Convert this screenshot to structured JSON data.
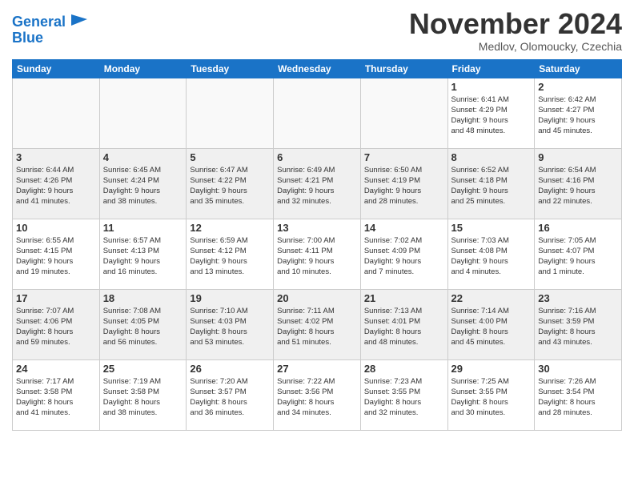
{
  "logo": {
    "line1": "General",
    "line2": "Blue"
  },
  "title": "November 2024",
  "subtitle": "Medlov, Olomoucky, Czechia",
  "weekdays": [
    "Sunday",
    "Monday",
    "Tuesday",
    "Wednesday",
    "Thursday",
    "Friday",
    "Saturday"
  ],
  "weeks": [
    [
      {
        "day": "",
        "info": ""
      },
      {
        "day": "",
        "info": ""
      },
      {
        "day": "",
        "info": ""
      },
      {
        "day": "",
        "info": ""
      },
      {
        "day": "",
        "info": ""
      },
      {
        "day": "1",
        "info": "Sunrise: 6:41 AM\nSunset: 4:29 PM\nDaylight: 9 hours\nand 48 minutes."
      },
      {
        "day": "2",
        "info": "Sunrise: 6:42 AM\nSunset: 4:27 PM\nDaylight: 9 hours\nand 45 minutes."
      }
    ],
    [
      {
        "day": "3",
        "info": "Sunrise: 6:44 AM\nSunset: 4:26 PM\nDaylight: 9 hours\nand 41 minutes."
      },
      {
        "day": "4",
        "info": "Sunrise: 6:45 AM\nSunset: 4:24 PM\nDaylight: 9 hours\nand 38 minutes."
      },
      {
        "day": "5",
        "info": "Sunrise: 6:47 AM\nSunset: 4:22 PM\nDaylight: 9 hours\nand 35 minutes."
      },
      {
        "day": "6",
        "info": "Sunrise: 6:49 AM\nSunset: 4:21 PM\nDaylight: 9 hours\nand 32 minutes."
      },
      {
        "day": "7",
        "info": "Sunrise: 6:50 AM\nSunset: 4:19 PM\nDaylight: 9 hours\nand 28 minutes."
      },
      {
        "day": "8",
        "info": "Sunrise: 6:52 AM\nSunset: 4:18 PM\nDaylight: 9 hours\nand 25 minutes."
      },
      {
        "day": "9",
        "info": "Sunrise: 6:54 AM\nSunset: 4:16 PM\nDaylight: 9 hours\nand 22 minutes."
      }
    ],
    [
      {
        "day": "10",
        "info": "Sunrise: 6:55 AM\nSunset: 4:15 PM\nDaylight: 9 hours\nand 19 minutes."
      },
      {
        "day": "11",
        "info": "Sunrise: 6:57 AM\nSunset: 4:13 PM\nDaylight: 9 hours\nand 16 minutes."
      },
      {
        "day": "12",
        "info": "Sunrise: 6:59 AM\nSunset: 4:12 PM\nDaylight: 9 hours\nand 13 minutes."
      },
      {
        "day": "13",
        "info": "Sunrise: 7:00 AM\nSunset: 4:11 PM\nDaylight: 9 hours\nand 10 minutes."
      },
      {
        "day": "14",
        "info": "Sunrise: 7:02 AM\nSunset: 4:09 PM\nDaylight: 9 hours\nand 7 minutes."
      },
      {
        "day": "15",
        "info": "Sunrise: 7:03 AM\nSunset: 4:08 PM\nDaylight: 9 hours\nand 4 minutes."
      },
      {
        "day": "16",
        "info": "Sunrise: 7:05 AM\nSunset: 4:07 PM\nDaylight: 9 hours\nand 1 minute."
      }
    ],
    [
      {
        "day": "17",
        "info": "Sunrise: 7:07 AM\nSunset: 4:06 PM\nDaylight: 8 hours\nand 59 minutes."
      },
      {
        "day": "18",
        "info": "Sunrise: 7:08 AM\nSunset: 4:05 PM\nDaylight: 8 hours\nand 56 minutes."
      },
      {
        "day": "19",
        "info": "Sunrise: 7:10 AM\nSunset: 4:03 PM\nDaylight: 8 hours\nand 53 minutes."
      },
      {
        "day": "20",
        "info": "Sunrise: 7:11 AM\nSunset: 4:02 PM\nDaylight: 8 hours\nand 51 minutes."
      },
      {
        "day": "21",
        "info": "Sunrise: 7:13 AM\nSunset: 4:01 PM\nDaylight: 8 hours\nand 48 minutes."
      },
      {
        "day": "22",
        "info": "Sunrise: 7:14 AM\nSunset: 4:00 PM\nDaylight: 8 hours\nand 45 minutes."
      },
      {
        "day": "23",
        "info": "Sunrise: 7:16 AM\nSunset: 3:59 PM\nDaylight: 8 hours\nand 43 minutes."
      }
    ],
    [
      {
        "day": "24",
        "info": "Sunrise: 7:17 AM\nSunset: 3:58 PM\nDaylight: 8 hours\nand 41 minutes."
      },
      {
        "day": "25",
        "info": "Sunrise: 7:19 AM\nSunset: 3:58 PM\nDaylight: 8 hours\nand 38 minutes."
      },
      {
        "day": "26",
        "info": "Sunrise: 7:20 AM\nSunset: 3:57 PM\nDaylight: 8 hours\nand 36 minutes."
      },
      {
        "day": "27",
        "info": "Sunrise: 7:22 AM\nSunset: 3:56 PM\nDaylight: 8 hours\nand 34 minutes."
      },
      {
        "day": "28",
        "info": "Sunrise: 7:23 AM\nSunset: 3:55 PM\nDaylight: 8 hours\nand 32 minutes."
      },
      {
        "day": "29",
        "info": "Sunrise: 7:25 AM\nSunset: 3:55 PM\nDaylight: 8 hours\nand 30 minutes."
      },
      {
        "day": "30",
        "info": "Sunrise: 7:26 AM\nSunset: 3:54 PM\nDaylight: 8 hours\nand 28 minutes."
      }
    ]
  ]
}
